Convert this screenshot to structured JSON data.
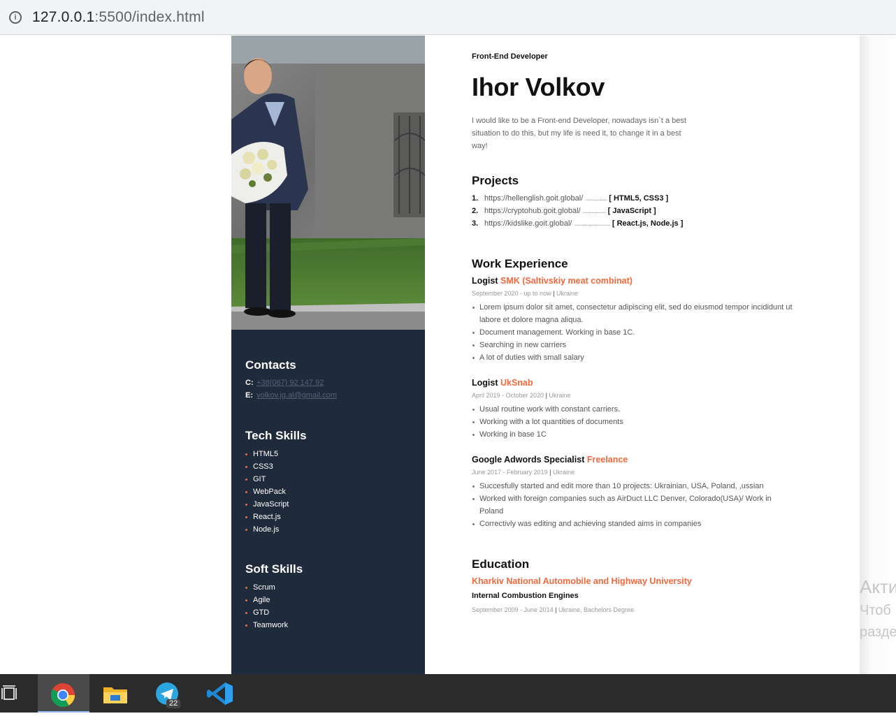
{
  "browser": {
    "url_host": "127.0.0.1",
    "url_path": ":5500/index.html"
  },
  "sidebar": {
    "contacts_title": "Contacts",
    "phone_label": "C:",
    "phone": "+38(067) 92 147 92",
    "email_label": "E:",
    "email": "volkov.jg.al@gmail.com",
    "tech_title": "Tech Skills",
    "tech_skills": [
      "HTML5",
      "CSS3",
      "GIT",
      "WebPack",
      "JavaScript",
      "React.js",
      "Node.js"
    ],
    "soft_title": "Soft Skills",
    "soft_skills": [
      "Scrum",
      "Agile",
      "GTD",
      "Teamwork"
    ]
  },
  "main": {
    "subtitle": "Front-End Developer",
    "name": "Ihor Volkov",
    "about": "I would like to be a Front-end Developer, nowadays isn`t a best situation to do this, but my life is need it, to change it in a best way!",
    "projects_title": "Projects",
    "projects": [
      {
        "num": "1.",
        "url": "https://hellenglish.goit.global/",
        "dots": "...............",
        "tech": "[ HTML5, CSS3 ]"
      },
      {
        "num": "2.",
        "url": "https://cryptohub.goit.global/",
        "dots": "................",
        "tech": "[ JavaScript ]"
      },
      {
        "num": "3.",
        "url": "https://kidslike.goit.global/",
        "dots": ".........................",
        "tech": "[ React.js, Node.js ]"
      }
    ],
    "work_title": "Work Experience",
    "jobs": [
      {
        "role": "Logist",
        "org": "SMK (Saltivskiy meat combinat)",
        "dates": "September 2020 - up to now",
        "place": "Ukraine",
        "bullets": [
          "Lorem ipsum dolor sit amet, consectetur adipiscing elit, sed do eiusmod tempor incididunt ut labore et dolore magna aliqua.",
          "Document management. Working in base 1C.",
          "Searching in new carriers",
          "A lot of duties with small salary"
        ]
      },
      {
        "role": "Logist",
        "org": "UkSnab",
        "dates": "April 2019 - October 2020",
        "place": "Ukraine",
        "bullets": [
          "Usual routine work with constant carriers.",
          "Working with a lot quantities of documents",
          "Working in base 1C"
        ]
      },
      {
        "role": "Google Adwords Specialist",
        "org": "Freelance",
        "dates": "June 2017 - February 2019",
        "place": "Ukraine",
        "bullets": [
          "Succesfully started and edit more than 10 projects: Ukrainian, USA, Poland, ,ussian",
          "Worked with foreign companies such as AirDuct LLC Denver, Colorado(USA)/ Work in Poland",
          "Correctivly was editing and achieving standed aims in companies"
        ]
      }
    ],
    "education_title": "Education",
    "university": "Kharkiv National Automobile and Highway University",
    "specialty": "Internal Combustion Engines",
    "edu_dates": "September 2009 - June 2014",
    "edu_place": "Ukraine, Bachelors Degree"
  },
  "overlay": {
    "line1": "Акти",
    "line2": "Чтоб",
    "line3": "разде"
  },
  "taskbar": {
    "telegram_badge": "22"
  },
  "colors": {
    "sidebar_bg": "#1f2a3b",
    "accent": "#f2683c"
  }
}
